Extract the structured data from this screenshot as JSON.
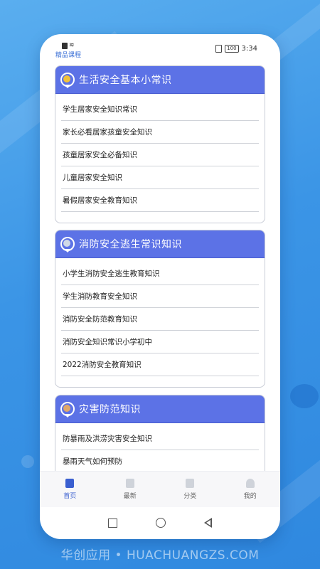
{
  "colors": {
    "accent": "#5c72e6",
    "background": "#3b95e6",
    "tab_active": "#3a5fd0"
  },
  "status_bar": {
    "app_label": "精品课程",
    "time": "3:34",
    "battery": "100"
  },
  "sections": [
    {
      "title": "生活安全基本小常识",
      "icon": "gold-medal-icon",
      "items": [
        "学生居家安全知识常识",
        "家长必看居家孩童安全知识",
        "孩童居家安全必备知识",
        "儿童居家安全知识",
        "暑假居家安全教育知识"
      ]
    },
    {
      "title": "消防安全逃生常识知识",
      "icon": "silver-medal-icon",
      "items": [
        "小学生消防安全逃生教育知识",
        "学生消防教育安全知识",
        "消防安全防范教育知识",
        "消防安全知识常识小学初中",
        "2022消防安全教育知识"
      ]
    },
    {
      "title": "灾害防范知识",
      "icon": "bronze-medal-icon",
      "items": [
        "防暴雨及洪涝灾害安全知识",
        "暴雨天气如何预防"
      ]
    }
  ],
  "tabs": [
    {
      "label": "首页",
      "icon": "home-icon",
      "active": true
    },
    {
      "label": "最新",
      "icon": "new-icon",
      "active": false
    },
    {
      "label": "分类",
      "icon": "grid-icon",
      "active": false
    },
    {
      "label": "我的",
      "icon": "user-icon",
      "active": false
    }
  ],
  "footer": {
    "watermark": "华创应用 • HUACHUANGZS.COM"
  }
}
